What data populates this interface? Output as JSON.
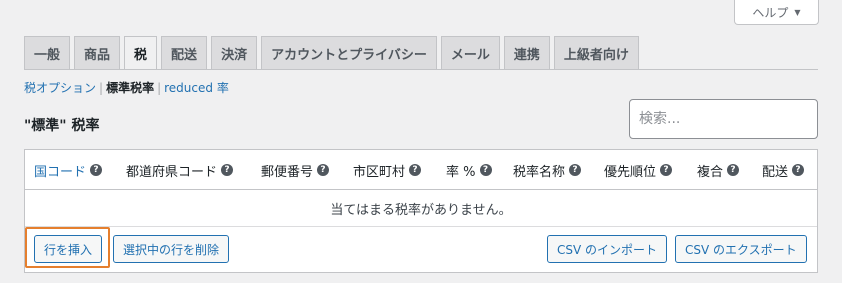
{
  "help": {
    "label": "ヘルプ",
    "caret": "▼"
  },
  "tabs": [
    {
      "label": "一般"
    },
    {
      "label": "商品"
    },
    {
      "label": "税"
    },
    {
      "label": "配送"
    },
    {
      "label": "決済"
    },
    {
      "label": "アカウントとプライバシー"
    },
    {
      "label": "メール"
    },
    {
      "label": "連携"
    },
    {
      "label": "上級者向け"
    }
  ],
  "active_tab": "税",
  "subsections": {
    "tax_options": "税オプション",
    "standard_rates": "標準税率",
    "reduced_rate": "reduced 率",
    "separator": "|"
  },
  "section_title": "\"標準\" 税率",
  "search": {
    "placeholder": "検索..."
  },
  "table": {
    "columns": [
      {
        "label": "国コード",
        "sortable": true
      },
      {
        "label": "都道府県コード",
        "sortable": false
      },
      {
        "label": "郵便番号",
        "sortable": false
      },
      {
        "label": "市区町村",
        "sortable": false
      },
      {
        "label": "率 %",
        "sortable": false
      },
      {
        "label": "税率名称",
        "sortable": false
      },
      {
        "label": "優先順位",
        "sortable": false
      },
      {
        "label": "複合",
        "sortable": false
      },
      {
        "label": "配送",
        "sortable": false
      }
    ],
    "help_glyph": "?",
    "empty_message": "当てはまる税率がありません。"
  },
  "buttons": {
    "insert_row": "行を挿入",
    "delete_selected": "選択中の行を削除",
    "import_csv": "CSV のインポート",
    "export_csv": "CSV のエクスポート"
  },
  "colors": {
    "accent": "#2271b1",
    "highlight": "#e57f2e",
    "background": "#f0f0f1"
  }
}
